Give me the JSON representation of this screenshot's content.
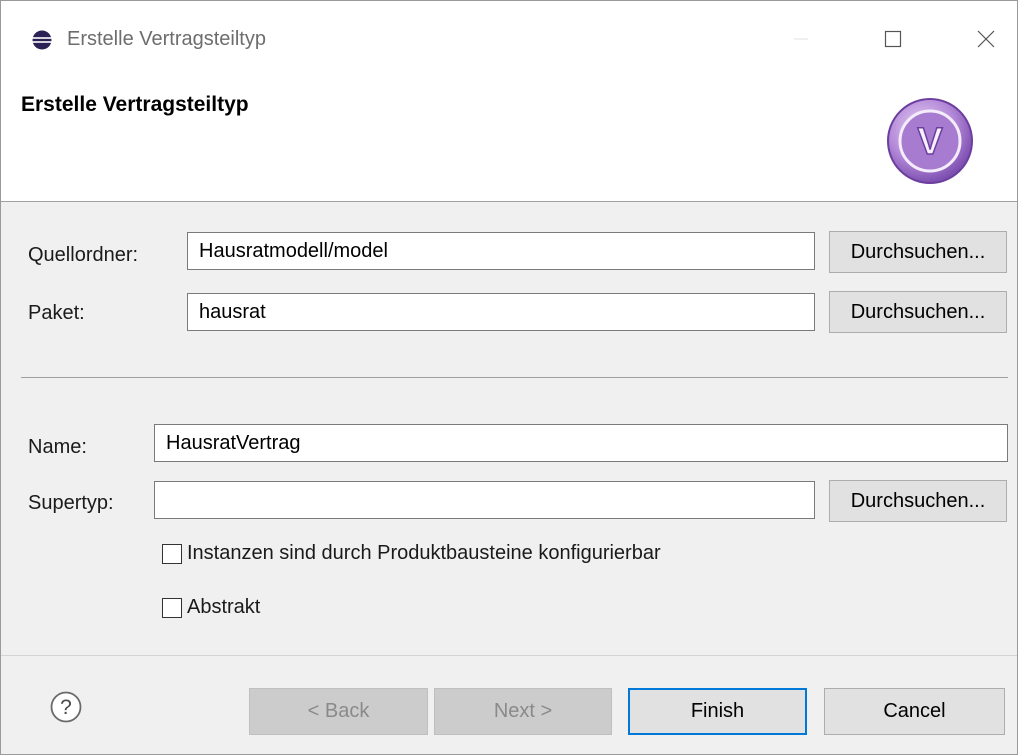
{
  "window": {
    "title": "Erstelle Vertragsteiltyp",
    "icon": "eclipse-icon"
  },
  "header": {
    "title": "Erstelle Vertragsteiltyp",
    "logo": "v-wizard-logo",
    "logo_letter": "V",
    "logo_color": "#9c6fc7"
  },
  "form": {
    "source_folder": {
      "label": "Quellordner:",
      "value": "Hausratmodell/model",
      "browse_label": "Durchsuchen..."
    },
    "package": {
      "label": "Paket:",
      "value": "hausrat",
      "browse_label": "Durchsuchen..."
    },
    "name": {
      "label": "Name:",
      "value": "HausratVertrag"
    },
    "supertype": {
      "label": "Supertyp:",
      "value": "",
      "browse_label": "Durchsuchen..."
    },
    "configurable": {
      "label": "Instanzen sind durch Produktbausteine konfigurierbar",
      "checked": false
    },
    "abstract": {
      "label": "Abstrakt",
      "checked": false
    }
  },
  "footer": {
    "help_icon": "help-icon",
    "back_label": "< Back",
    "next_label": "Next >",
    "finish_label": "Finish",
    "cancel_label": "Cancel"
  },
  "colors": {
    "accent": "#0078d7",
    "logo": "#9c6fc7"
  }
}
